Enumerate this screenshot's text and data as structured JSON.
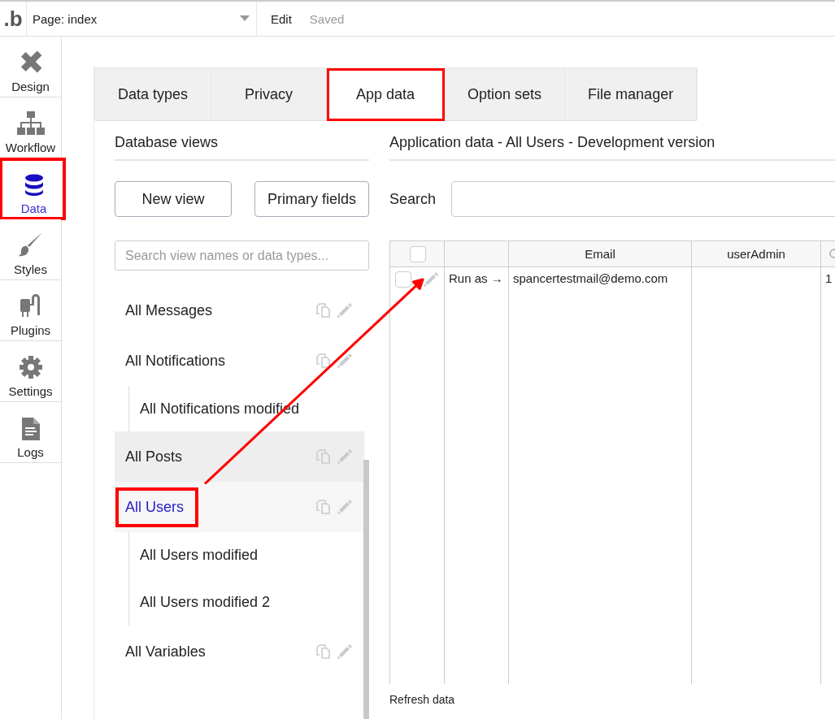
{
  "topbar": {
    "logo": ".b",
    "page_select": "Page: index",
    "edit": "Edit",
    "status": "Saved"
  },
  "nav": [
    {
      "label": "Design",
      "selected": false,
      "highlighted": false
    },
    {
      "label": "Workflow",
      "selected": false,
      "highlighted": false
    },
    {
      "label": "Data",
      "selected": true,
      "highlighted": true
    },
    {
      "label": "Styles",
      "selected": false,
      "highlighted": false
    },
    {
      "label": "Plugins",
      "selected": false,
      "highlighted": false
    },
    {
      "label": "Settings",
      "selected": false,
      "highlighted": false
    },
    {
      "label": "Logs",
      "selected": false,
      "highlighted": false
    }
  ],
  "tabs": [
    {
      "label": "Data types",
      "selected": false,
      "highlighted": false
    },
    {
      "label": "Privacy",
      "selected": false,
      "highlighted": false
    },
    {
      "label": "App data",
      "selected": true,
      "highlighted": true
    },
    {
      "label": "Option sets",
      "selected": false,
      "highlighted": false
    },
    {
      "label": "File manager",
      "selected": false,
      "highlighted": false
    }
  ],
  "views_panel": {
    "title": "Database views",
    "buttons": [
      "New view",
      "Primary fields"
    ],
    "search": {
      "placeholder": "Search view names or data types..."
    },
    "views": [
      {
        "label": "All Messages",
        "selected": false,
        "hovered": false,
        "highlighted": false
      },
      {
        "label": "All Notifications",
        "selected": false,
        "hovered": false,
        "highlighted": false,
        "children": [
          {
            "label": "All Notifications modified"
          }
        ]
      },
      {
        "label": "All Posts",
        "selected": false,
        "hovered": true,
        "highlighted": false
      },
      {
        "label": "All Users",
        "selected": true,
        "hovered": false,
        "highlighted": true,
        "children": [
          {
            "label": "All Users modified"
          },
          {
            "label": "All Users modified 2"
          }
        ]
      },
      {
        "label": "All Variables",
        "selected": false,
        "hovered": false,
        "highlighted": false
      }
    ]
  },
  "data_panel": {
    "title": "Application data - All Users - Development version",
    "search_label": "Search",
    "table": {
      "header_checked": false,
      "columns": [
        "Email",
        "userAdmin"
      ],
      "rows": [
        {
          "checked": false,
          "run_as": "Run as →",
          "email": "spancertestmail@demo.com",
          "column_5": "1"
        }
      ]
    },
    "refresh": "Refresh data"
  },
  "arrow_shown": true
}
